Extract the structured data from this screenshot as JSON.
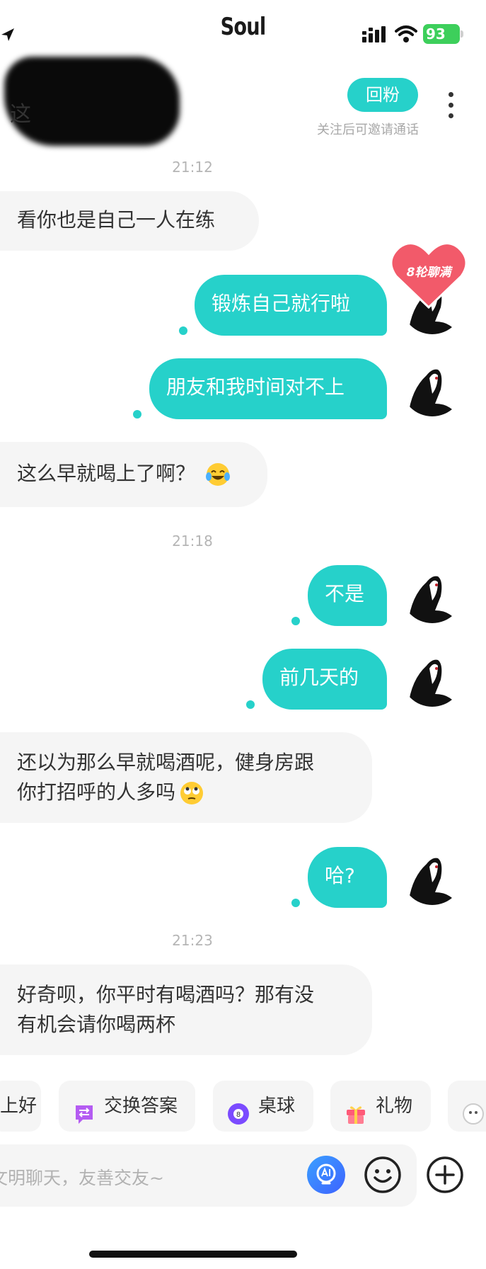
{
  "status_bar": {
    "app_title": "Soul",
    "battery": "93",
    "icons": [
      "location-arrow-icon",
      "signal-icon",
      "wifi-icon",
      "battery-icon"
    ]
  },
  "header": {
    "name_partial": "这",
    "follow_back_label": "回粉",
    "follow_hint": "关注后可邀请通话",
    "more_icon": "more-vertical-icon"
  },
  "timestamps": [
    "21:12",
    "21:18",
    "21:23"
  ],
  "messages": [
    {
      "side": "in",
      "text": "看你也是自己一人在练"
    },
    {
      "side": "out",
      "text": "锻炼自己就行啦"
    },
    {
      "side": "out",
      "text": "朋友和我时间对不上"
    },
    {
      "side": "in",
      "text": "这么早就喝上了啊？",
      "emoji": "tears-of-joy-emoji"
    },
    {
      "side": "out",
      "text": "不是"
    },
    {
      "side": "out",
      "text": "前几天的"
    },
    {
      "side": "in",
      "line1": "还以为那么早就喝酒呢，健身房跟",
      "line2": "你打招呼的人多吗",
      "emoji": "rolling-eyes-emoji"
    },
    {
      "side": "out",
      "text": "哈?"
    },
    {
      "side": "in",
      "line1": "好奇呗，你平时有喝酒吗？那有没",
      "line2": "有机会请你喝两杯"
    }
  ],
  "badge": {
    "text": "8轮聊满",
    "color": "#f25a6a"
  },
  "chips": [
    {
      "label": "上好",
      "icon": "none"
    },
    {
      "label": "交换答案",
      "icon": "swap-chat-icon"
    },
    {
      "label": "桌球",
      "icon": "billiard-ball-icon"
    },
    {
      "label": "礼物",
      "icon": "gift-icon"
    }
  ],
  "input": {
    "placeholder": "文明聊天，友善交友~",
    "buttons": [
      "ai-assistant-icon",
      "emoji-smile-icon",
      "plus-icon"
    ]
  },
  "colors": {
    "accent": "#26d1ca",
    "bubble_in": "#f5f5f5",
    "badge": "#f25a6a"
  }
}
